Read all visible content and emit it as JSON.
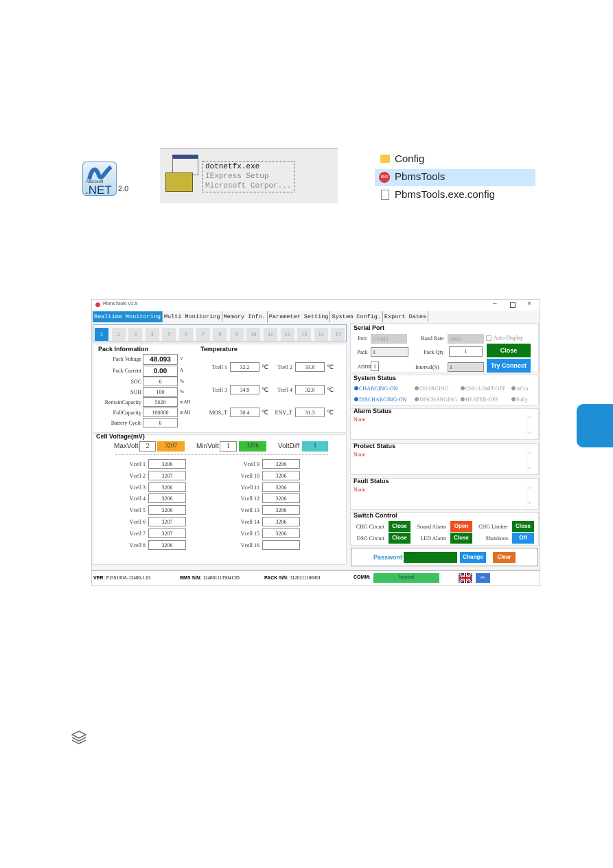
{
  "top": {
    "net_label": "2.0",
    "net_logo_text": "Microsoft .NET",
    "installer": {
      "line1": "dotnetfx.exe",
      "line2": "IExpress Setup",
      "line3": "Microsoft Corpor..."
    },
    "files": [
      {
        "name": "Config",
        "icon": "folder-icon"
      },
      {
        "name": "PbmsTools",
        "icon": "app-icon",
        "selected": true
      },
      {
        "name": "PbmsTools.exe.config",
        "icon": "file-icon"
      }
    ]
  },
  "app": {
    "title": "PbmsTools V2.5",
    "tabs": [
      "Realtime Monitoring",
      "Multi Monitoring",
      "Memory Info.",
      "Parameter Setting",
      "System Config.",
      "Export Dates"
    ],
    "pack_buttons": [
      "1",
      "2",
      "3",
      "4",
      "5",
      "6",
      "7",
      "8",
      "9",
      "10",
      "11",
      "12",
      "13",
      "14",
      "15"
    ],
    "pack_info": {
      "title": "Pack Information",
      "rows": [
        {
          "label": "Pack Voltage",
          "value": "48.093",
          "unit": "V"
        },
        {
          "label": "Pack Current",
          "value": "0.00",
          "unit": "A"
        },
        {
          "label": "SOC",
          "value": "6",
          "unit": "%"
        },
        {
          "label": "SOH",
          "value": "100",
          "unit": "%"
        },
        {
          "label": "RemainCapacity",
          "value": "5620",
          "unit": "mAH"
        },
        {
          "label": "FullCapacity",
          "value": "100000",
          "unit": "mAH"
        },
        {
          "label": "Battery Cycle",
          "value": "0",
          "unit": ""
        }
      ]
    },
    "temperature": {
      "title": "Temperature",
      "unit": "℃",
      "items": [
        {
          "label": "Tcell 1",
          "value": "32.2"
        },
        {
          "label": "Tcell 2",
          "value": "33.6"
        },
        {
          "label": "Tcell 3",
          "value": "34.9"
        },
        {
          "label": "Tcell 4",
          "value": "32.0"
        },
        {
          "label": "MOS_T",
          "value": "30.4"
        },
        {
          "label": "ENV_T",
          "value": "31.3"
        }
      ]
    },
    "cell_voltage": {
      "title": "Cell Voltage(mV)",
      "max_label": "MaxVolt",
      "max_index": "2",
      "max_value": "3207",
      "min_label": "MinVolt",
      "min_index": "1",
      "min_value": "3206",
      "diff_label": "VoltDiff",
      "diff_value": "1",
      "cells": [
        {
          "label": "Vcell 1",
          "value": "3206"
        },
        {
          "label": "Vcell 2",
          "value": "3207"
        },
        {
          "label": "Vcell 3",
          "value": "3206"
        },
        {
          "label": "Vcell 4",
          "value": "3206"
        },
        {
          "label": "Vcell 5",
          "value": "3206"
        },
        {
          "label": "Vcell 6",
          "value": "3207"
        },
        {
          "label": "Vcell 7",
          "value": "3207"
        },
        {
          "label": "Vcell 8",
          "value": "3206"
        },
        {
          "label": "Vcell 9",
          "value": "3206"
        },
        {
          "label": "Vcell 10",
          "value": "3206"
        },
        {
          "label": "Vcell 11",
          "value": "3206"
        },
        {
          "label": "Vcell 12",
          "value": "3206"
        },
        {
          "label": "Vcell 13",
          "value": "3206"
        },
        {
          "label": "Vcell 14",
          "value": "3206"
        },
        {
          "label": "Vcell 15",
          "value": "3206"
        },
        {
          "label": "Vcell 16",
          "value": ""
        }
      ]
    },
    "serial": {
      "title": "Serial Port",
      "port_label": "Port",
      "port_value": "COM3",
      "baud_label": "Baud Rate",
      "baud_value": "9600",
      "auto_display": "Auto Display",
      "pack_label": "Pack",
      "pack_value": "1",
      "packqty_label": "Pack Qty",
      "packqty_value": "1",
      "addr_label": "ADDR",
      "addr_value": "1",
      "interval_label": "Interval(S)",
      "interval_value": "1",
      "close_btn": "Close",
      "connect_btn": "Try Connect"
    },
    "system_status": {
      "title": "System Status",
      "items": [
        {
          "label": "CHARGING-ON",
          "active": true
        },
        {
          "label": "CHARGING",
          "active": false
        },
        {
          "label": "CHG-LIMIT-OFF",
          "active": false
        },
        {
          "label": "ACin",
          "active": false
        },
        {
          "label": "DISCHARGING-ON",
          "active": true
        },
        {
          "label": "DISCHARGING",
          "active": false
        },
        {
          "label": "HEATER-OFF",
          "active": false
        },
        {
          "label": "Fully",
          "active": false
        }
      ]
    },
    "alarm": {
      "title": "Alarm Status",
      "value": "None"
    },
    "protect": {
      "title": "Protect Status",
      "value": "None"
    },
    "fault": {
      "title": "Fault Status",
      "value": "None"
    },
    "switch": {
      "title": "Switch Control",
      "items": [
        {
          "label": "CHG Circuit",
          "state": "Close",
          "color": "#0a7a14"
        },
        {
          "label": "Sound Alarm",
          "state": "Open",
          "color": "#f0501e"
        },
        {
          "label": "CHG Limiter",
          "state": "Close",
          "color": "#0a7a14"
        },
        {
          "label": "DSG Circuit",
          "state": "Close",
          "color": "#0a7a14"
        },
        {
          "label": "LED Alarm",
          "state": "Close",
          "color": "#0a7a14"
        },
        {
          "label": "Shutdown",
          "state": "Off",
          "color": "#1e90e8"
        }
      ]
    },
    "password": {
      "label": "Password",
      "value": "••••••",
      "change": "Change",
      "clear": "Clear"
    },
    "status_bar": {
      "ver_label": "VER:",
      "ver": "P15S100A-12480-1.03",
      "bms_label": "BMS S/N:",
      "bms": "12480111390413D",
      "pack_label": "PACK S/N:",
      "pack": "3120211100001",
      "comm_label": "COMM:",
      "comm": "Normal"
    }
  },
  "colors": {
    "accent": "#1e8fd6",
    "green": "#0a7a14",
    "orange": "#f5a623",
    "light_green": "#3cc03c",
    "teal": "#4cc8c8"
  }
}
